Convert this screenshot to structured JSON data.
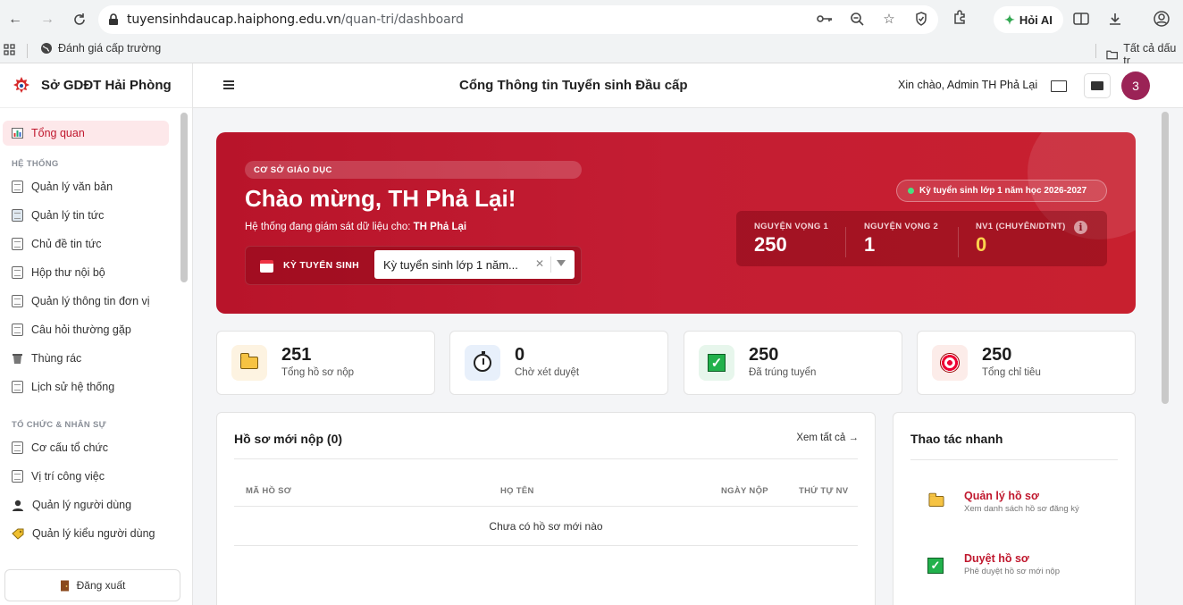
{
  "browser": {
    "url_host": "tuyensinhdaucap.haiphong.edu.vn",
    "url_path": "/quan-tri/dashboard",
    "ai_button": "Hỏi AI",
    "bookmark_1": "Đánh giá cấp trường",
    "all_bookmarks": "Tất cả dấu tr"
  },
  "brand": {
    "name": "Sở GDĐT Hải Phòng"
  },
  "sidebar": {
    "overview": "Tổng quan",
    "section_system": "HỆ THỐNG",
    "system_items": [
      "Quản lý văn bản",
      "Quản lý tin tức",
      "Chủ đề tin tức",
      "Hộp thư nội bộ",
      "Quản lý thông tin đơn vị",
      "Câu hỏi thường gặp",
      "Thùng rác",
      "Lịch sử hệ thống"
    ],
    "section_org": "TỔ CHỨC & NHÂN SỰ",
    "org_items": [
      "Cơ cấu tổ chức",
      "Vị trí công việc",
      "Quản lý người dùng",
      "Quản lý kiểu người dùng"
    ],
    "logout": "Đăng xuất"
  },
  "header": {
    "title": "Cổng Thông tin Tuyển sinh Đầu cấp",
    "greeting": "Xin chào, Admin TH Phả Lại",
    "avatar_text": "3"
  },
  "hero": {
    "badge": "CƠ SỞ GIÁO DỤC",
    "title": "Chào mừng, TH Phả Lại!",
    "subtitle_prefix": "Hệ thống đang giám sát dữ liệu cho:",
    "subtitle_name": "TH Phả Lại",
    "period_label": "KỲ TUYỂN SINH",
    "period_select": "Kỳ tuyển sinh lớp 1 năm...",
    "period_pill": "Kỳ tuyển sinh lớp 1 năm học 2026-2027",
    "stats": [
      {
        "label": "NGUYỆN VỌNG 1",
        "value": "250"
      },
      {
        "label": "NGUYỆN VỌNG 2",
        "value": "1"
      },
      {
        "label": "NV1 (CHUYÊN/DTNT)",
        "value": "0"
      }
    ]
  },
  "cards": [
    {
      "value": "251",
      "caption": "Tổng hồ sơ nộp",
      "icon": "folder-icon"
    },
    {
      "value": "0",
      "caption": "Chờ xét duyệt",
      "icon": "stopwatch-icon"
    },
    {
      "value": "250",
      "caption": "Đã trúng tuyển",
      "icon": "check-icon"
    },
    {
      "value": "250",
      "caption": "Tổng chỉ tiêu",
      "icon": "target-icon"
    }
  ],
  "recent": {
    "title": "Hồ sơ mới nộp (0)",
    "view_all": "Xem tất cả →",
    "columns": [
      "MÃ HỒ SƠ",
      "HỌ TÊN",
      "NGÀY NỘP",
      "THỨ TỰ NV"
    ],
    "empty": "Chưa có hồ sơ mới nào"
  },
  "quick": {
    "title": "Thao tác nhanh",
    "items": [
      {
        "title": "Quản lý hồ sơ",
        "desc": "Xem danh sách hồ sơ đăng ký"
      },
      {
        "title": "Duyệt hồ sơ",
        "desc": "Phê duyệt hồ sơ mới nộp"
      }
    ]
  }
}
